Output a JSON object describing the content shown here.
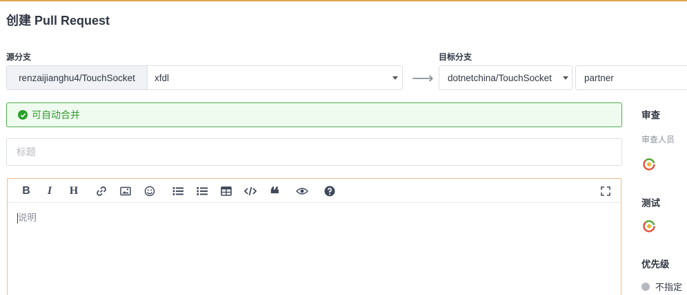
{
  "page": {
    "title": "创建 Pull Request"
  },
  "source": {
    "label": "源分支",
    "repo": "renzaijianghu4/TouchSocket",
    "branch": "xfdl"
  },
  "target": {
    "label": "目标分支",
    "repo": "dotnetchina/TouchSocket",
    "branch": "partner"
  },
  "merge_status": {
    "text": "可自动合并",
    "color": "#2c9a2c"
  },
  "title_input": {
    "placeholder": "标题",
    "value": ""
  },
  "editor": {
    "placeholder": "说明",
    "toolbar": [
      "bold-icon",
      "italic-icon",
      "heading-icon",
      "link-icon",
      "image-icon",
      "emoji-icon",
      "bullet-list-icon",
      "numbered-list-icon",
      "table-icon",
      "code-icon",
      "quote-icon",
      "preview-icon",
      "help-icon",
      "fullscreen-icon"
    ],
    "toolbar_glyphs": {
      "bold": "B",
      "italic": "I",
      "heading": "H"
    }
  },
  "sidebar": {
    "review": {
      "heading": "审查",
      "reviewers_label": "审查人员"
    },
    "testing": {
      "heading": "测试"
    },
    "priority": {
      "heading": "优先级",
      "value": "不指定"
    }
  },
  "colors": {
    "accent_orange": "#dca44e",
    "success_green": "#2ca02c",
    "editor_border": "#f0b98a"
  }
}
